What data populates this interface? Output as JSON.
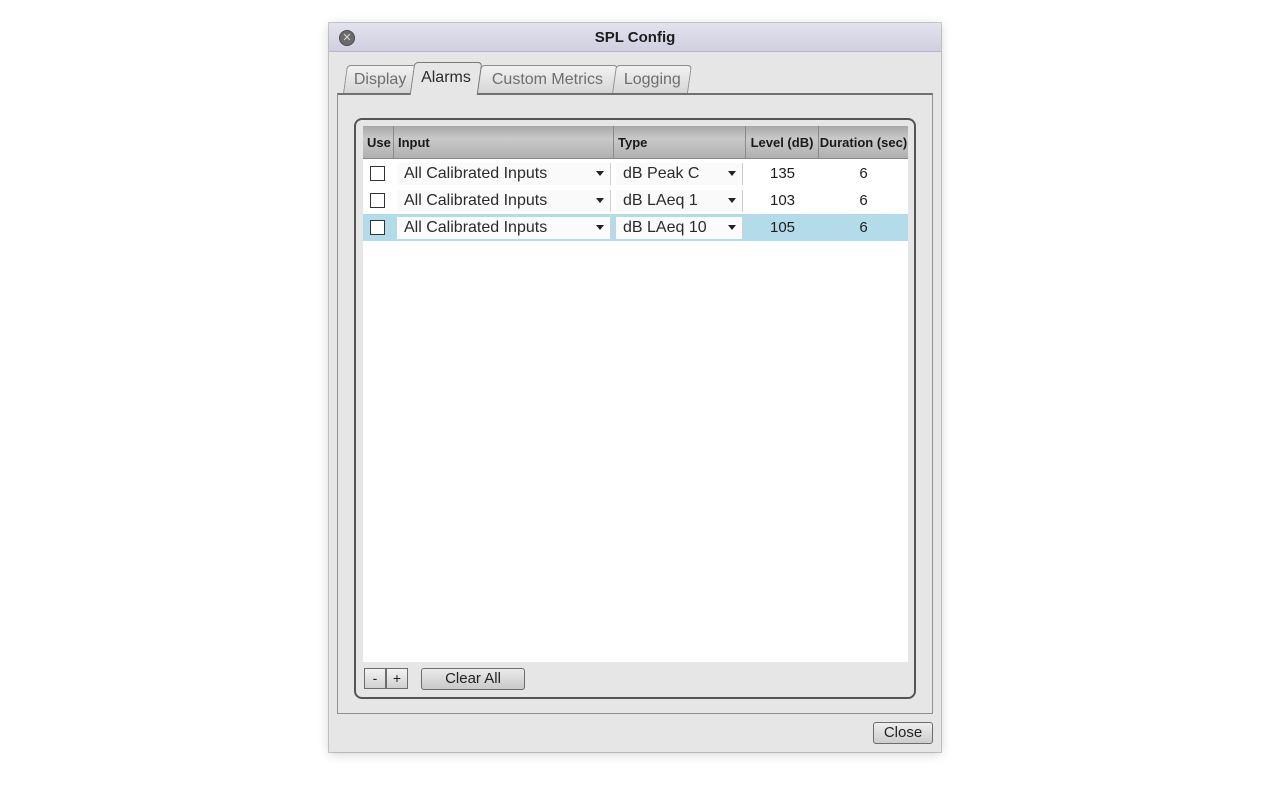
{
  "window": {
    "title": "SPL Config"
  },
  "tabs": [
    {
      "label": "Display",
      "active": false
    },
    {
      "label": "Alarms",
      "active": true
    },
    {
      "label": "Custom Metrics",
      "active": false
    },
    {
      "label": "Logging",
      "active": false
    }
  ],
  "table": {
    "columns": [
      "Use",
      "Input",
      "Type",
      "Level (dB)",
      "Duration (sec)"
    ],
    "rows": [
      {
        "use": false,
        "input": "All Calibrated Inputs",
        "type": "dB Peak C",
        "level": "135",
        "duration": "6",
        "selected": false
      },
      {
        "use": false,
        "input": "All Calibrated Inputs",
        "type": "dB LAeq 1",
        "level": "103",
        "duration": "6",
        "selected": false
      },
      {
        "use": false,
        "input": "All Calibrated Inputs",
        "type": "dB LAeq 10",
        "level": "105",
        "duration": "6",
        "selected": true
      }
    ]
  },
  "buttons": {
    "remove": "-",
    "add": "+",
    "clear_all": "Clear All",
    "close": "Close"
  },
  "colors": {
    "selected_row": "#b4dbe9",
    "titlebar": "#d8d8e6"
  },
  "icons": {
    "window_close": "close-icon",
    "dropdown": "chevron-down-icon"
  }
}
